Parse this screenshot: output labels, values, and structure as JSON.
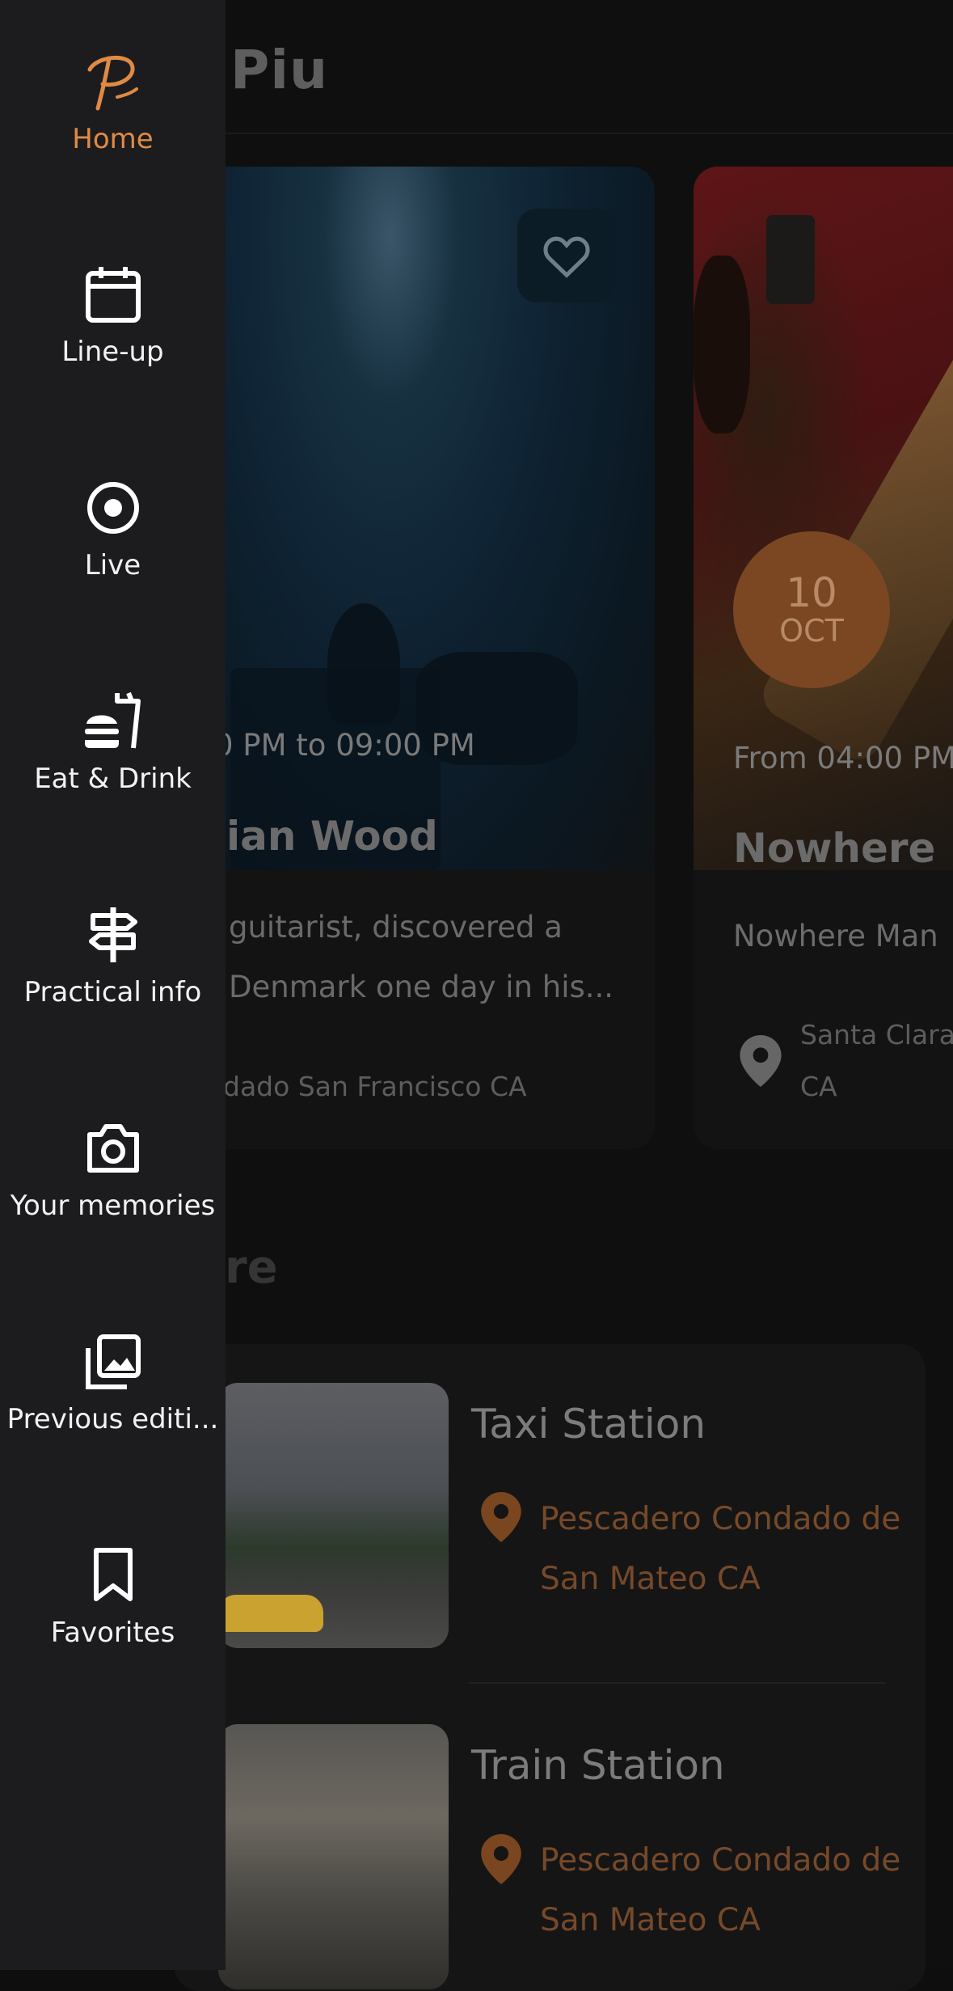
{
  "header": {
    "title": "Piu"
  },
  "cards": [
    {
      "time": "0 PM to 09:00 PM",
      "title": "ian Wood",
      "desc_line1": "guitarist, discovered a",
      "desc_line2": "Denmark one day in his...",
      "location": "dado San Francisco CA"
    },
    {
      "date_day": "10",
      "date_month": "OCT",
      "time": "From 04:00 PM",
      "title": "Nowhere M",
      "subtitle": "Nowhere Man",
      "location_line1": "Santa Clara",
      "location_line2": "CA"
    }
  ],
  "section": {
    "title": "ere"
  },
  "places": [
    {
      "title": "Taxi Station",
      "addr_line1": "Pescadero Condado de",
      "addr_line2": "San Mateo CA"
    },
    {
      "title": "Train Station",
      "addr_line1": "Pescadero Condado de",
      "addr_line2": "San Mateo CA"
    }
  ],
  "drawer": {
    "items": [
      {
        "label": "Home",
        "icon": "piu-logo-icon",
        "active": true
      },
      {
        "label": "Line-up",
        "icon": "calendar-icon"
      },
      {
        "label": "Live",
        "icon": "live-record-icon"
      },
      {
        "label": "Eat & Drink",
        "icon": "food-icon"
      },
      {
        "label": "Practical info",
        "icon": "signpost-icon"
      },
      {
        "label": "Your memories",
        "icon": "camera-icon"
      },
      {
        "label": "Previous editi...",
        "icon": "gallery-icon"
      },
      {
        "label": "Favorites",
        "icon": "bookmark-icon"
      }
    ]
  },
  "colors": {
    "accent": "#e08a45",
    "drawer_bg": "#1c1c1e",
    "address": "#76492a"
  }
}
